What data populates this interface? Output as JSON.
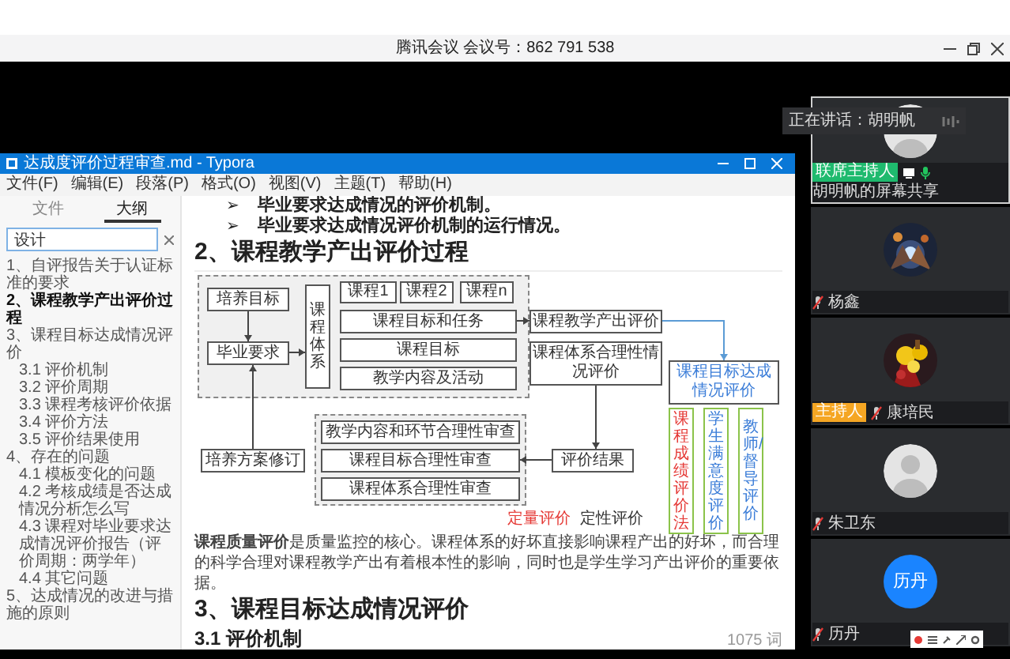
{
  "meeting_bar": {
    "title": "腾讯会议 会议号：862 791 538"
  },
  "typora": {
    "title": "达成度评价过程审查.md - Typora",
    "menu": [
      "文件(F)",
      "编辑(E)",
      "段落(P)",
      "格式(O)",
      "视图(V)",
      "主题(T)",
      "帮助(H)"
    ],
    "sidebar_tabs": [
      {
        "label": "文件",
        "selected": false
      },
      {
        "label": "大纲",
        "selected": true
      }
    ],
    "search": {
      "value": "设计"
    },
    "outline": [
      {
        "label": "1、自评报告关于认证标准的要求",
        "selected": false
      },
      {
        "label": "2、课程教学产出评价过程",
        "selected": true
      },
      {
        "label": "3、课程目标达成情况评价",
        "selected": false,
        "children": [
          {
            "label": "3.1 评价机制",
            "selected": false
          },
          {
            "label": "3.2 评价周期",
            "selected": false
          },
          {
            "label": "3.3 课程考核评价依据",
            "selected": false
          },
          {
            "label": "3.4 评价方法",
            "selected": false
          },
          {
            "label": "3.5 评价结果使用",
            "selected": false
          }
        ]
      },
      {
        "label": "4、存在的问题",
        "selected": false,
        "children": [
          {
            "label": "4.1 模板变化的问题",
            "selected": false
          },
          {
            "label": "4.2 考核成绩是否达成情况分析怎么写",
            "selected": false
          },
          {
            "label": "4.3 课程对毕业要求达成情况评价报告（评价周期：两学年）",
            "selected": false
          },
          {
            "label": "4.4 其它问题",
            "selected": false
          }
        ]
      },
      {
        "label": "5、达成情况的改进与措施的原则",
        "selected": false
      }
    ],
    "document": {
      "bullets": [
        {
          "marker": "➢",
          "text": "毕业要求达成情况的评价机制。"
        },
        {
          "marker": "➢",
          "text": "毕业要求达成情况评价机制的运行情况。"
        }
      ],
      "heading_2": "2、课程教学产出评价过程",
      "diagram": {
        "nodes": [
          {
            "label": "培养目标",
            "kind": "box",
            "color": "#333333"
          },
          {
            "label": "毕业要求",
            "kind": "box",
            "color": "#333333"
          },
          {
            "label": "课程体系",
            "kind": "vertical",
            "color": "#333333"
          },
          {
            "label": "课程1",
            "kind": "box",
            "color": "#333333"
          },
          {
            "label": "课程2",
            "kind": "box",
            "color": "#333333"
          },
          {
            "label": "课程n",
            "kind": "box",
            "color": "#333333"
          },
          {
            "label": "课程目标和任务",
            "kind": "box",
            "color": "#333333"
          },
          {
            "label": "课程目标",
            "kind": "box",
            "color": "#333333"
          },
          {
            "label": "教学内容及活动",
            "kind": "box",
            "color": "#333333"
          },
          {
            "label": "教学内容和环节合理性审查",
            "kind": "box",
            "color": "#333333"
          },
          {
            "label": "课程目标合理性审查",
            "kind": "box",
            "color": "#333333"
          },
          {
            "label": "课程体系合理性审查",
            "kind": "box",
            "color": "#333333"
          },
          {
            "label": "培养方案修订",
            "kind": "box",
            "color": "#333333"
          },
          {
            "label": "课程教学产出评价",
            "kind": "box",
            "color": "#333333"
          },
          {
            "label": "课程体系合理性情况评价",
            "kind": "box",
            "color": "#333333"
          },
          {
            "label": "评价结果",
            "kind": "box",
            "color": "#333333"
          },
          {
            "label": "课程目标达成情况评价",
            "kind": "box",
            "color": "#3b7dd8"
          },
          {
            "label": "定量评价",
            "kind": "legend",
            "color": "#e53935"
          },
          {
            "label": "定性评价",
            "kind": "legend",
            "color": "#333333"
          },
          {
            "label": "课程成绩评价法",
            "kind": "metric",
            "color": "#e53935"
          },
          {
            "label": "学生满意度评价",
            "kind": "metric",
            "color": "#3b7dd8"
          },
          {
            "label": "教师/督导评价",
            "kind": "metric",
            "color": "#3b7dd8"
          }
        ]
      },
      "paragraph": "**课程质量评价**是质量监控的核心。课程体系的好坏直接影响课程产出的好坏，而合理的科学合理对课程教学产出有着根本性的影响，同时也是学生学习产出评价的重要依据。",
      "heading_3": "3、课程目标达成情况评价",
      "heading_3_1": "3.1 评价机制",
      "word_count": "1075 词"
    }
  },
  "speaking": {
    "label": "正在讲话：胡明帆"
  },
  "participants": [
    {
      "name": "胡明帆的屏幕共享",
      "avatar": {
        "kind": "default"
      },
      "active": true,
      "muted": false,
      "sharing": true,
      "badge": {
        "label": "联席主持人",
        "color": "#1fba6e"
      }
    },
    {
      "name": "杨鑫",
      "active": false,
      "muted": true,
      "sharing": false
    },
    {
      "name": "康培民",
      "active": false,
      "muted": true,
      "sharing": false,
      "badge": {
        "label": "主持人",
        "color": "#f5a623"
      }
    },
    {
      "name": "朱卫东",
      "avatar": {
        "kind": "default"
      },
      "active": false,
      "muted": true,
      "sharing": false
    },
    {
      "name": "历丹",
      "avatar": {
        "kind": "initials",
        "text": "历丹"
      },
      "active": false,
      "muted": true,
      "sharing": false
    }
  ]
}
